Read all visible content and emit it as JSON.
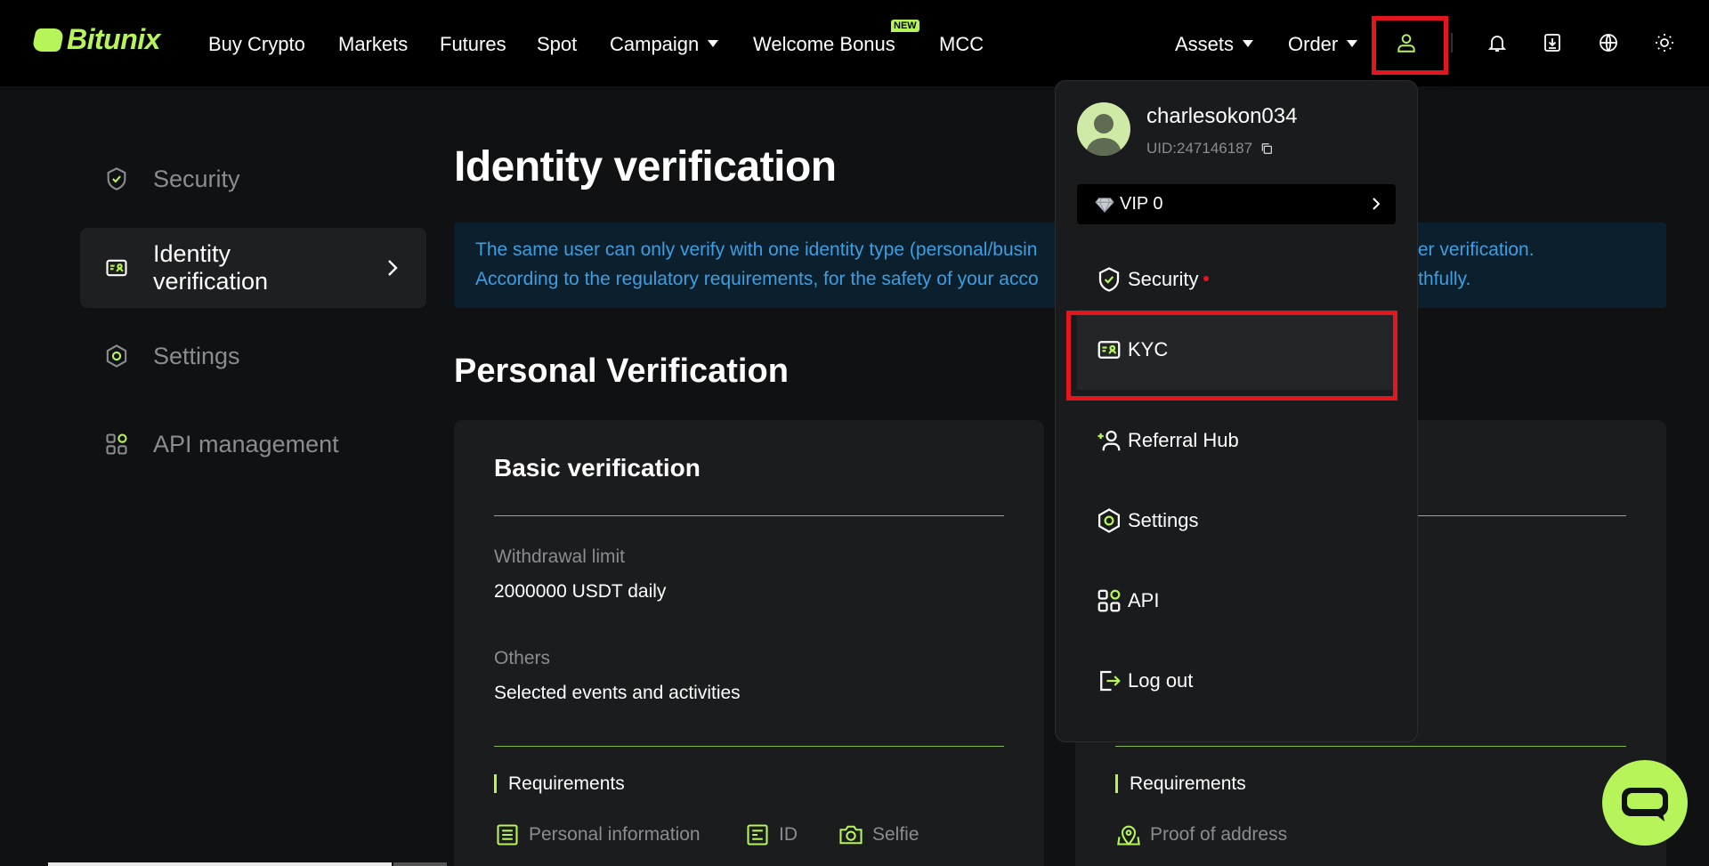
{
  "brand": {
    "name": "Bitunix",
    "accent": "#b7f45a",
    "highlight": "#e3161e",
    "notice_color": "#3d9ee2"
  },
  "nav": {
    "items": [
      {
        "label": "Buy Crypto"
      },
      {
        "label": "Markets"
      },
      {
        "label": "Futures"
      },
      {
        "label": "Spot"
      },
      {
        "label": "Campaign"
      },
      {
        "label": "Welcome Bonus"
      },
      {
        "label": "MCC"
      }
    ],
    "new_badge": "NEW",
    "right": {
      "assets": "Assets",
      "order": "Order"
    },
    "icons": [
      "user-icon",
      "bell-icon",
      "download-icon",
      "globe-icon",
      "sun-icon"
    ]
  },
  "sidebar": {
    "items": [
      {
        "label": "Security",
        "icon": "shield-check-icon"
      },
      {
        "label": "Identity verification",
        "icon": "id-card-icon"
      },
      {
        "label": "Settings",
        "icon": "settings-hex-icon"
      },
      {
        "label": "API management",
        "icon": "grid-icon"
      }
    ]
  },
  "main": {
    "title": "Identity verification",
    "notice_line1": "The same user can only verify with one identity type (personal/busin",
    "notice_line1_end": "after verification.",
    "notice_line2": "According to the regulatory requirements, for the safety of your acco",
    "notice_line2_end": "truthfully.",
    "section_title": "Personal Verification",
    "basic": {
      "title": "Basic verification",
      "withdrawal_label": "Withdrawal limit",
      "withdrawal_value": "2000000 USDT daily",
      "others_label": "Others",
      "others_value": "Selected events and activities",
      "requirements_title": "Requirements",
      "requirements": [
        {
          "label": "Personal information",
          "icon": "document-icon"
        },
        {
          "label": "ID",
          "icon": "id-icon"
        },
        {
          "label": "Selfie",
          "icon": "camera-icon"
        }
      ]
    },
    "advanced": {
      "requirements_title": "Requirements",
      "requirements": [
        {
          "label": "Proof of address",
          "icon": "map-pin-icon"
        }
      ]
    }
  },
  "dropdown": {
    "username": "charlesokon034",
    "uid": "UID:247146187",
    "vip": "VIP 0",
    "items": [
      {
        "label": "Security",
        "icon": "shield-check-icon"
      },
      {
        "label": "KYC",
        "icon": "id-card-icon"
      },
      {
        "label": "Referral Hub",
        "icon": "add-user-icon"
      },
      {
        "label": "Settings",
        "icon": "settings-hex-icon"
      },
      {
        "label": "API",
        "icon": "grid-icon"
      },
      {
        "label": "Log out",
        "icon": "logout-icon"
      }
    ]
  }
}
